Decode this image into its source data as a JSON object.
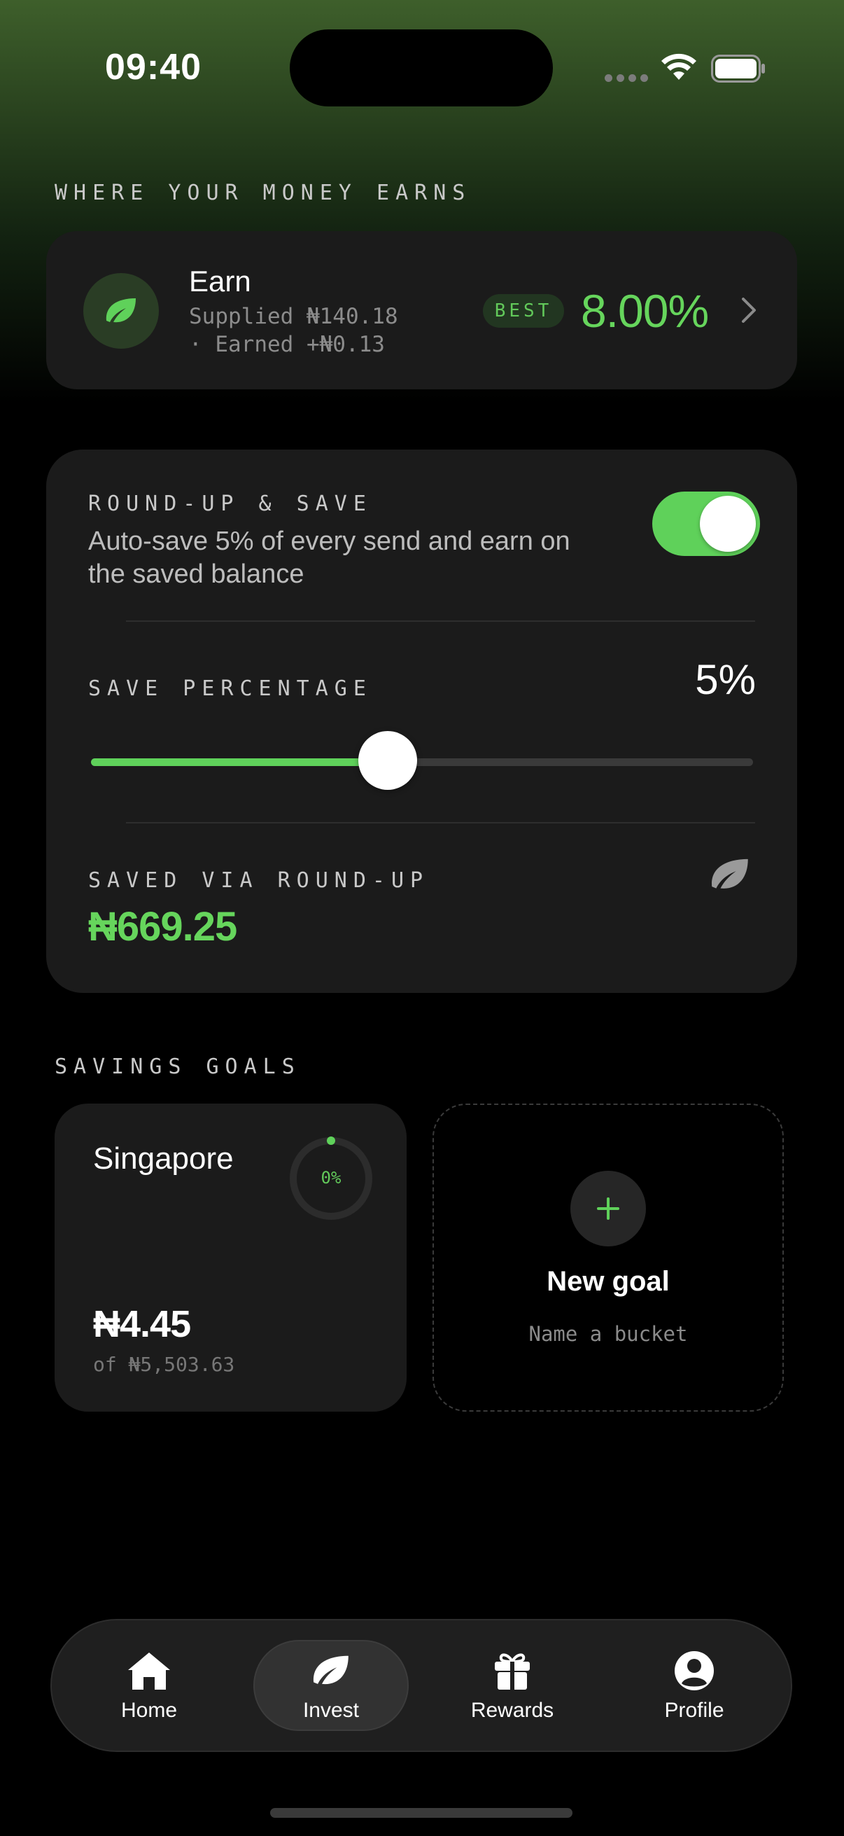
{
  "status": {
    "time": "09:40"
  },
  "earn_section": {
    "label": "WHERE YOUR MONEY EARNS",
    "card": {
      "title": "Earn",
      "supplied": "Supplied ₦140.18",
      "earned": "· Earned +₦0.13",
      "badge": "BEST",
      "rate": "8.00%",
      "icon": "leaf-icon"
    }
  },
  "round_up": {
    "label": "ROUND-UP & SAVE",
    "description": "Auto-save 5% of every send and earn on the saved balance",
    "toggle_on": true,
    "save_percentage_label": "SAVE PERCENTAGE",
    "save_percentage_value": "5%",
    "slider_fraction": 0.45,
    "saved_label": "SAVED VIA ROUND-UP",
    "saved_value": "₦669.25"
  },
  "savings_goals": {
    "label": "SAVINGS GOALS",
    "goals": [
      {
        "name": "Singapore",
        "progress": "0%",
        "amount": "₦4.45",
        "target": "of ₦5,503.63"
      }
    ],
    "new_goal": {
      "title": "New goal",
      "subtitle": "Name a bucket"
    }
  },
  "tabs": [
    {
      "label": "Home",
      "icon": "home-icon",
      "active": false
    },
    {
      "label": "Invest",
      "icon": "leaf-icon",
      "active": true
    },
    {
      "label": "Rewards",
      "icon": "gift-icon",
      "active": false
    },
    {
      "label": "Profile",
      "icon": "profile-icon",
      "active": false
    }
  ],
  "colors": {
    "accent": "#66d55c",
    "card": "#1b1b1b",
    "background": "#000000"
  }
}
